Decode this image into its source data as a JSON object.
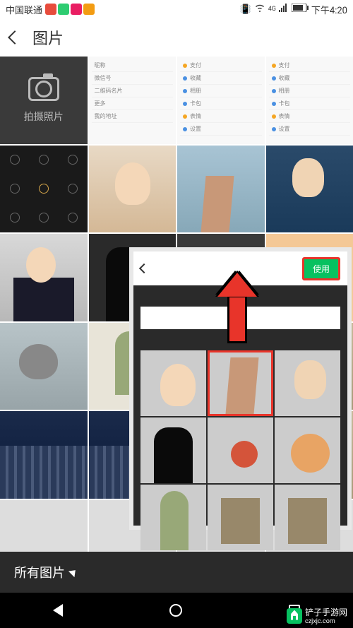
{
  "status": {
    "carrier": "中国联通",
    "time": "下午4:20",
    "signal_text": "4G"
  },
  "header": {
    "title": "图片"
  },
  "camera": {
    "label": "拍摄照片"
  },
  "settings_labels": {
    "nickname": "昵称",
    "wechat_id": "微信号",
    "qr": "二维码名片",
    "more": "更多",
    "address": "我的地址",
    "pay": "支付",
    "collect": "收藏",
    "album": "相册",
    "card": "卡包",
    "emoji": "表情",
    "setting": "设置"
  },
  "overlay": {
    "use_button": "使用"
  },
  "bottom_bar": {
    "label": "所有图片"
  },
  "watermark": {
    "text": "铲子手游网",
    "url": "czjxjc.com"
  }
}
